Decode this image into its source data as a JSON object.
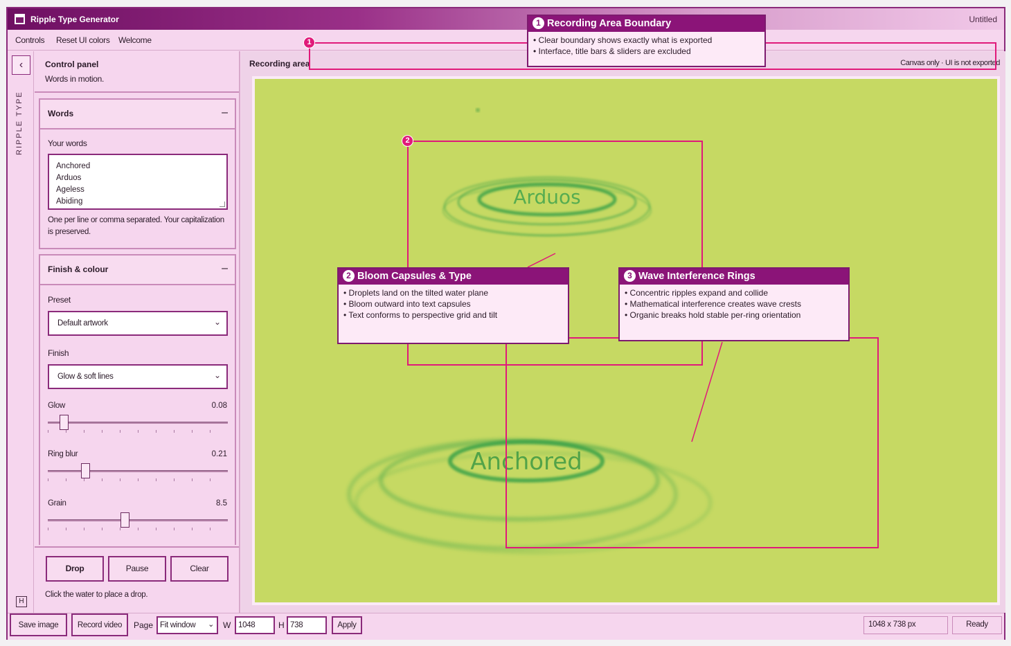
{
  "window": {
    "title": "Ripple Type Generator",
    "document": "Untitled"
  },
  "menu": [
    "Controls",
    "Reset UI colors",
    "Welcome"
  ],
  "rail": {
    "vertical_label": "RIPPLE TYPE",
    "help_key": "H"
  },
  "panel": {
    "title": "Control panel",
    "subtitle": "Words in motion.",
    "words": {
      "header": "Words",
      "field_label": "Your words",
      "lines": [
        "Anchored",
        "Arduos",
        "Ageless",
        "Abiding"
      ],
      "help": "One per line or comma separated. Your capitalization is preserved."
    },
    "finish": {
      "header": "Finish & colour",
      "preset_label": "Preset",
      "preset_value": "Default artwork",
      "finish_label": "Finish",
      "finish_value": "Glow & soft lines",
      "sliders": [
        {
          "label": "Glow",
          "value": "0.08",
          "fraction": 0.09
        },
        {
          "label": "Ring blur",
          "value": "0.21",
          "fraction": 0.21
        },
        {
          "label": "Grain",
          "value": "8.5",
          "fraction": 0.43
        }
      ]
    },
    "buttons": {
      "drop": "Drop",
      "pause": "Pause",
      "clear": "Clear"
    },
    "hint": "Click the water to place a drop."
  },
  "main": {
    "recording_label": "Recording area",
    "note": "Canvas only · UI is not exported",
    "canvas_color": "#c6d963",
    "ripple_color": "#3ea34a",
    "words_on_canvas": [
      "Arduos",
      "Anchored"
    ]
  },
  "callouts": [
    {
      "num": "1",
      "title": "Recording Area Boundary",
      "bullets": [
        "Clear boundary shows exactly what is exported",
        "Interface, title bars & sliders are excluded"
      ]
    },
    {
      "num": "2",
      "title": "Bloom Capsules & Type",
      "bullets": [
        "Droplets land on the tilted water plane",
        "Bloom outward into text capsules",
        "Text conforms to perspective grid and tilt"
      ]
    },
    {
      "num": "3",
      "title": "Wave Interference Rings",
      "bullets": [
        "Concentric ripples expand and collide",
        "Mathematical interference creates wave crests",
        "Organic breaks hold stable per-ring orientation"
      ]
    }
  ],
  "statusbar": {
    "save": "Save image",
    "record": "Record video",
    "page_label": "Page",
    "page_value": "Fit window",
    "w_label": "W",
    "w_value": "1048",
    "h_label": "H",
    "h_value": "738",
    "apply": "Apply",
    "size": "1048 x 738 px",
    "status": "Ready"
  },
  "colors": {
    "accent": "#8b1478",
    "highlight": "#e0197a",
    "panel_bg": "#f6d6ee"
  }
}
